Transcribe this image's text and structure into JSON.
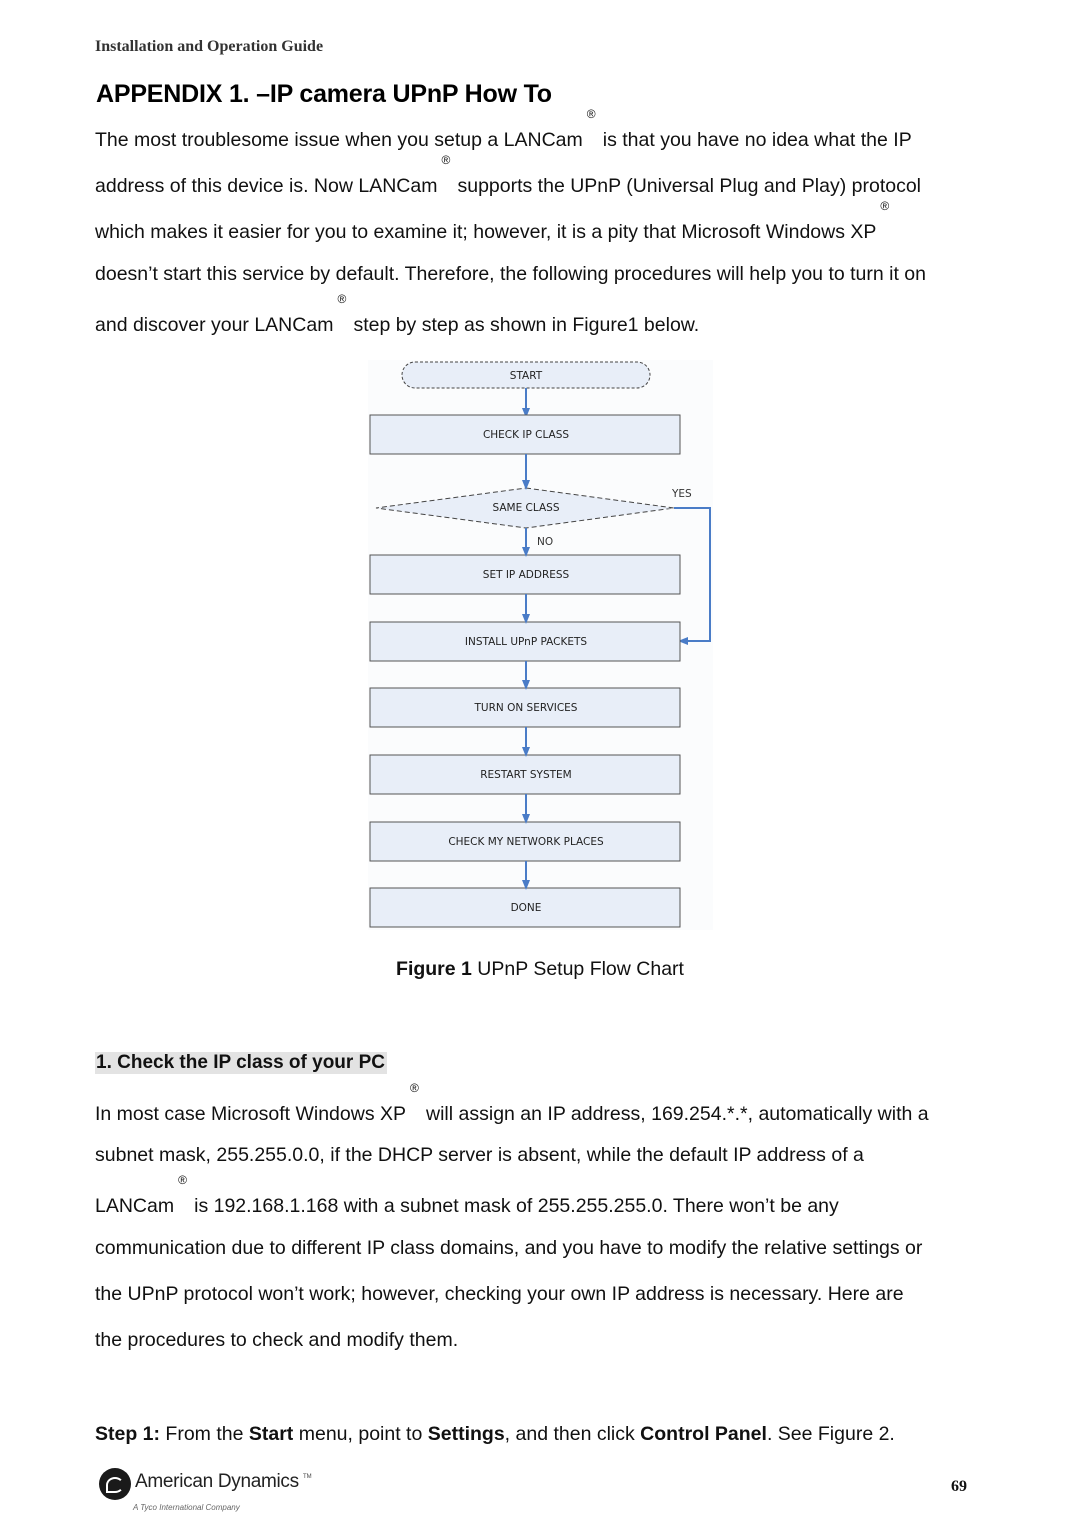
{
  "header": {
    "running_title": "Installation and Operation Guide"
  },
  "title": "APPENDIX 1. –IP camera UPnP How To",
  "intro": {
    "lines": [
      {
        "before": "The most troublesome issue when you setup a LANCam",
        "reg": "®",
        "after": "is that you have no idea what the IP"
      },
      {
        "before": "address of this device is. Now LANCam",
        "reg": "®",
        "after": "supports the UPnP (Universal Plug and Play) protocol"
      },
      {
        "before": "which makes it easier for you to examine it; however, it is a pity that Microsoft Windows XP",
        "reg": "®",
        "after": ""
      },
      {
        "before": "doesn’t start this service by default. Therefore, the following procedures will help you to turn it on",
        "reg": "",
        "after": ""
      },
      {
        "before": "and discover your LANCam",
        "reg": "®",
        "after": "step by step as shown in Figure1 below."
      }
    ]
  },
  "flowchart": {
    "start": "START",
    "decision": "SAME CLASS",
    "yes_label": "YES",
    "no_label": "NO",
    "steps": [
      "CHECK IP CLASS",
      "SET IP ADDRESS",
      "INSTALL UPnP PACKETS",
      "TURN ON SERVICES",
      "RESTART SYSTEM",
      "CHECK MY NETWORK PLACES",
      "DONE"
    ],
    "colors": {
      "box_fill": "#e8eef8",
      "arrow": "#4a7cc7",
      "border": "#555555"
    }
  },
  "figure_caption": {
    "label": "Figure 1",
    "text": " UPnP Setup Flow Chart"
  },
  "section": {
    "heading": "1. Check the IP class of your PC",
    "lines": [
      {
        "before": "In most case Microsoft Windows XP",
        "reg": "®",
        "after": "will assign an IP address, 169.254.*.*, automatically with a"
      },
      {
        "before": "subnet mask, 255.255.0.0, if the DHCP server is absent, while the default IP address of a",
        "reg": "",
        "after": ""
      },
      {
        "before": "LANCam",
        "reg": "®",
        "after": "is 192.168.1.168 with a subnet mask of 255.255.255.0. There won’t be any"
      },
      {
        "before": "communication due to different IP class domains, and you have to modify the relative settings or",
        "reg": "",
        "after": ""
      },
      {
        "before": "the UPnP protocol won’t work; however, checking your own IP address is necessary. Here are",
        "reg": "",
        "after": ""
      },
      {
        "before": "the procedures to check and modify them.",
        "reg": "",
        "after": ""
      }
    ]
  },
  "step1": {
    "label": "Step 1:",
    "t1": " From the ",
    "b1": "Start",
    "t2": " menu, point to ",
    "b2": "Settings",
    "t3": ", and then click ",
    "b3": "Control Panel",
    "t4": ". See Figure 2."
  },
  "footer": {
    "logo_name": "American Dynamics",
    "logo_tm": "TM",
    "logo_tagline": "A Tyco International Company",
    "page_number": "69"
  }
}
